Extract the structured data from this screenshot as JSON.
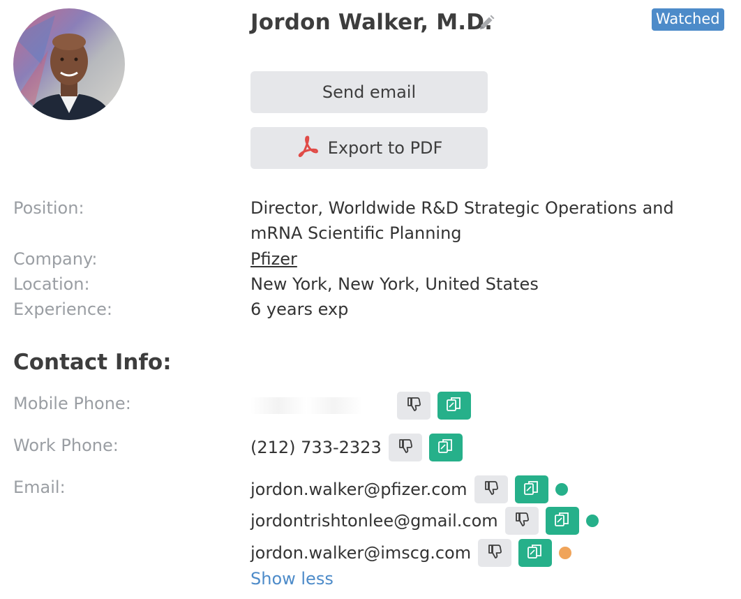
{
  "profile": {
    "name": "Jordon Walker, M.D.",
    "badge": "Watched"
  },
  "actions": {
    "send_email": "Send email",
    "export_pdf": "Export to PDF"
  },
  "details": {
    "position_label": "Position:",
    "position_line1": "Director, Worldwide R&D Strategic Operations and",
    "position_line2": "mRNA Scientific Planning",
    "company_label": "Company:",
    "company": "Pfizer",
    "location_label": "Location:",
    "location": "New York, New York, United States",
    "experience_label": "Experience:",
    "experience": "6 years exp"
  },
  "contact": {
    "title": "Contact Info:",
    "mobile_label": "Mobile Phone:",
    "work_label": "Work Phone:",
    "work_phone": "(212) 733-2323",
    "email_label": "Email:",
    "emails": [
      {
        "address": "jordon.walker@pfizer.com",
        "status": "green"
      },
      {
        "address": "jordontrishtonlee@gmail.com",
        "status": "green"
      },
      {
        "address": "jordon.walker@imscg.com",
        "status": "orange"
      }
    ],
    "show_less": "Show less"
  },
  "icons": {
    "edit": "pencil-icon",
    "pdf": "acrobat-icon",
    "dislike": "thumbs-down-icon",
    "copy": "copy-icon"
  },
  "colors": {
    "badge": "#4d8bc9",
    "copy_button": "#26b08a",
    "status_green": "#26b08a",
    "status_orange": "#f0a45a",
    "link": "#4d8bc9"
  }
}
